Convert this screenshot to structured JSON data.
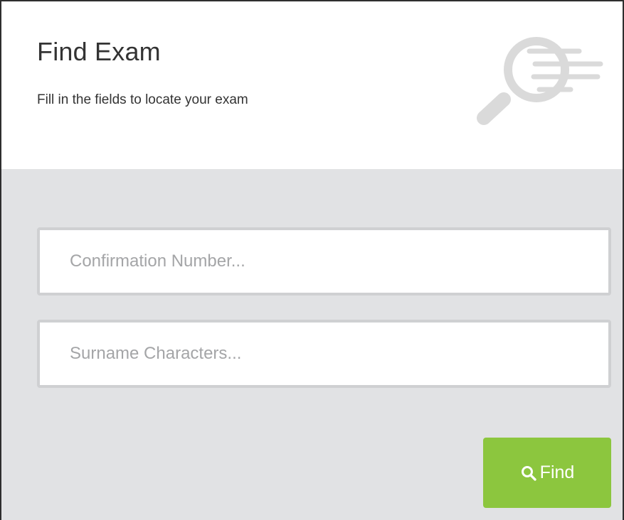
{
  "panel": {
    "title": "Find Exam",
    "subtitle": "Fill in the fields to locate your exam"
  },
  "form": {
    "confirmation_placeholder": "Confirmation Number...",
    "confirmation_value": "",
    "surname_placeholder": "Surname Characters...",
    "surname_value": ""
  },
  "actions": {
    "find_label": "Find"
  },
  "icons": {
    "header_icon": "magnifier-search-icon",
    "button_icon": "search-icon"
  },
  "colors": {
    "button": "#8cc63e",
    "panel_background": "#e1e2e4",
    "icon": "#dadada",
    "text": "#333333"
  }
}
